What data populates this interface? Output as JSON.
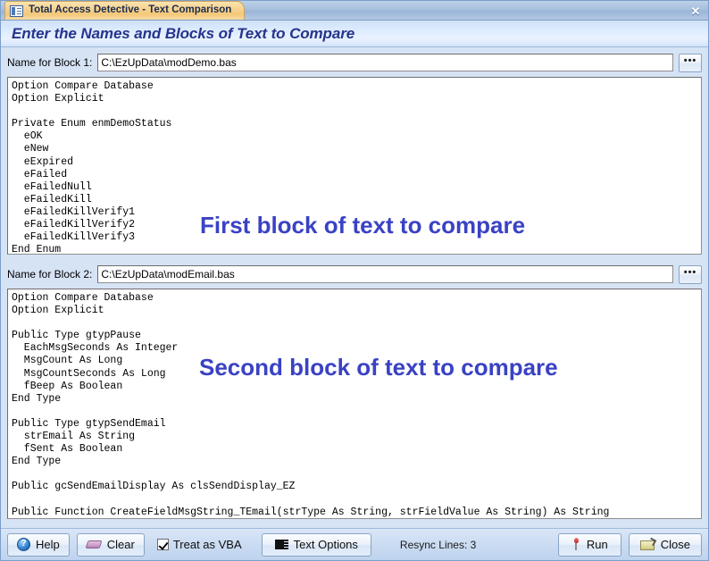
{
  "window": {
    "title": "Total Access Detective - Text Comparison",
    "tab_icon": "form-window-icon",
    "close_glyph": "✕"
  },
  "header": {
    "heading": "Enter the Names and Blocks of Text to Compare"
  },
  "block1": {
    "label": "Name for Block 1:",
    "value": "C:\\EzUpData\\modDemo.bas",
    "browse_label": "•••",
    "overlay": "First block of text to compare",
    "code": "Option Compare Database\nOption Explicit\n\nPrivate Enum enmDemoStatus\n  eOK\n  eNew\n  eExpired\n  eFailed\n  eFailedNull\n  eFailedKill\n  eFailedKillVerify1\n  eFailedKillVerify2\n  eFailedKillVerify3\nEnd Enum"
  },
  "block2": {
    "label": "Name for Block 2:",
    "value": "C:\\EzUpData\\modEmail.bas",
    "browse_label": "•••",
    "overlay": "Second block of text to compare",
    "code": "Option Compare Database\nOption Explicit\n\nPublic Type gtypPause\n  EachMsgSeconds As Integer\n  MsgCount As Long\n  MsgCountSeconds As Long\n  fBeep As Boolean\nEnd Type\n\nPublic Type gtypSendEmail\n  strEmail As String\n  fSent As Boolean\nEnd Type\n\nPublic gcSendEmailDisplay As clsSendDisplay_EZ\n\nPublic Function CreateFieldMsgString_TEmail(strType As String, strFieldValue As String) As String"
  },
  "toolbar": {
    "help_label": "Help",
    "clear_label": "Clear",
    "treat_as_vba_label": "Treat as VBA",
    "treat_as_vba_checked": true,
    "text_options_label": "Text Options",
    "status": "Resync Lines: 3",
    "run_label": "Run",
    "close_label": "Close"
  },
  "colors": {
    "accent_blue": "#3a42c4",
    "header_text": "#26348c",
    "tab_gold": "#f3c878",
    "titlebar_blue": "#a8c0de"
  }
}
